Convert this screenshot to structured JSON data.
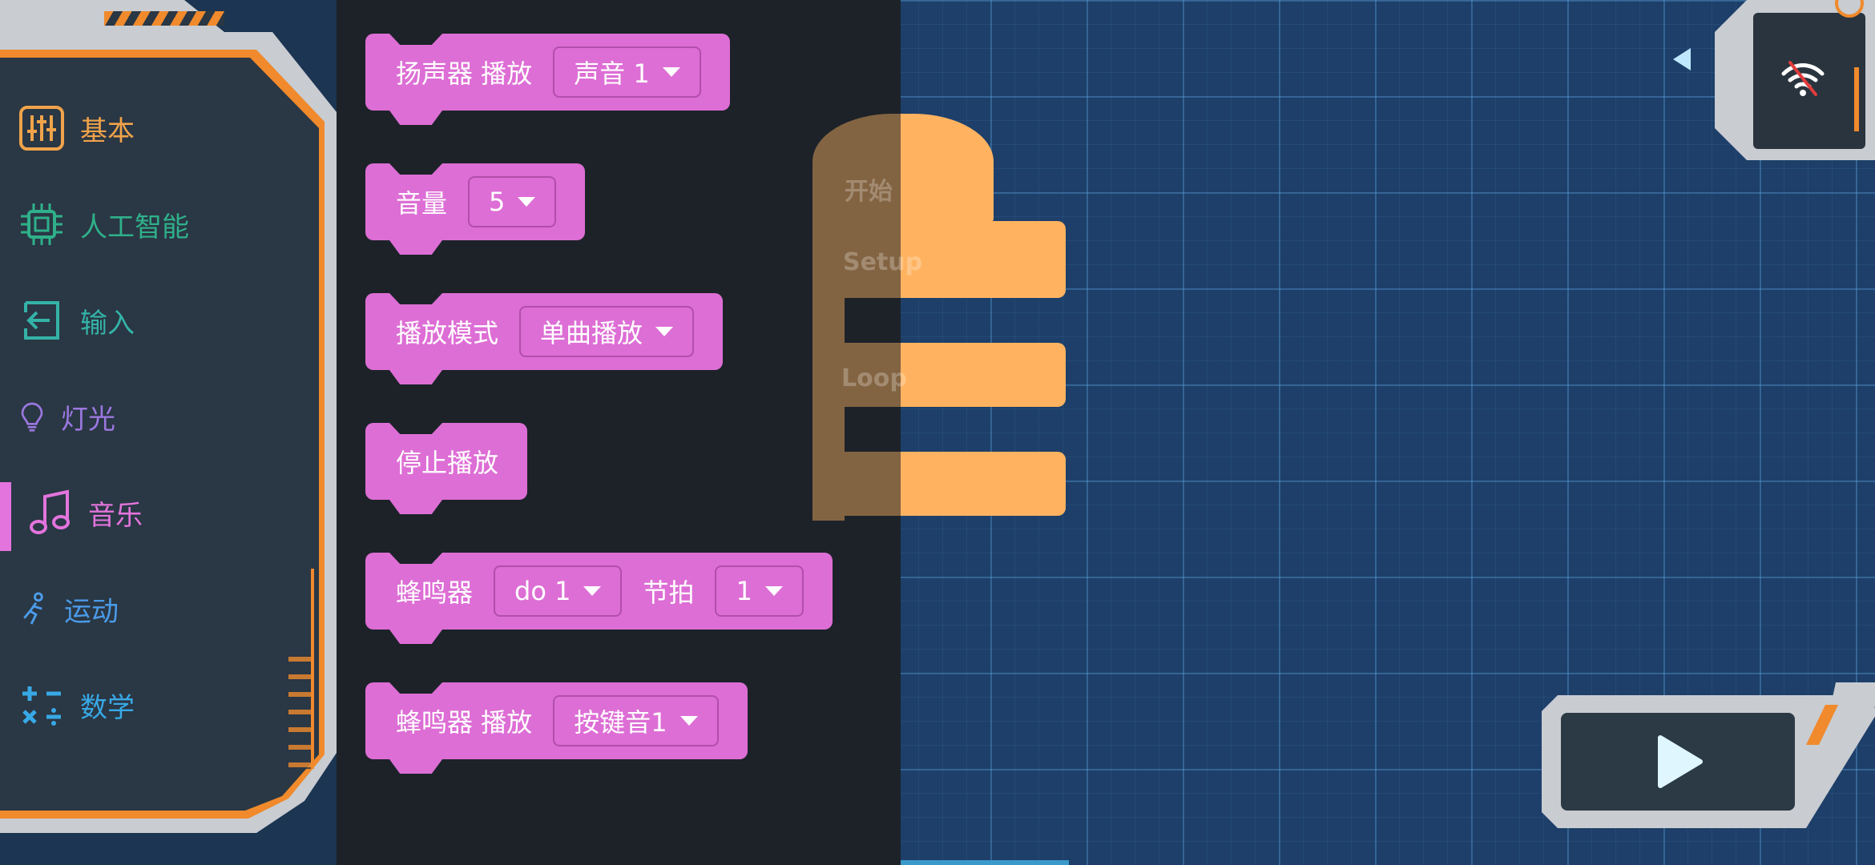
{
  "sidebar": {
    "categories": [
      {
        "label": "基本",
        "icon": "sliders-icon",
        "color": "#f0a34a"
      },
      {
        "label": "人工智能",
        "icon": "chip-icon",
        "color": "#2fb08a"
      },
      {
        "label": "输入",
        "icon": "input-arrow-icon",
        "color": "#34b3a8"
      },
      {
        "label": "灯光",
        "icon": "lightbulb-icon",
        "color": "#9b78e0"
      },
      {
        "label": "音乐",
        "icon": "music-note-icon",
        "color": "#e374dd"
      },
      {
        "label": "运动",
        "icon": "running-figure-icon",
        "color": "#4b9be8"
      },
      {
        "label": "数学",
        "icon": "math-symbols-icon",
        "color": "#38a9e6"
      }
    ],
    "active": "音乐"
  },
  "flyout": {
    "blocks": [
      {
        "label": "扬声器 播放",
        "dropdown": "声音 1"
      },
      {
        "label": "音量",
        "dropdown": "5"
      },
      {
        "label": "播放模式",
        "dropdown": "单曲播放"
      },
      {
        "label": "停止播放"
      },
      {
        "label": "蜂鸣器",
        "dropdown": "do 1",
        "label2": "节拍",
        "dropdown2": "1"
      },
      {
        "label": "蜂鸣器 播放",
        "dropdown": "按键音1"
      }
    ],
    "block_color": "#dd6ed5"
  },
  "workspace": {
    "event_block": {
      "hat": "开始",
      "setup": "Setup",
      "loop": "Loop"
    },
    "event_color": "#ffb360"
  },
  "toolbar": {
    "wifi": "wifi-off-icon",
    "run": "play-icon"
  }
}
